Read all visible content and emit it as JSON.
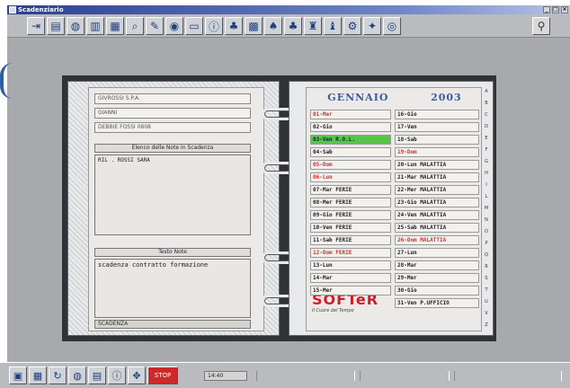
{
  "window": {
    "title": "Scadenziario"
  },
  "toolbar": {
    "icons": [
      "exit-door-icon",
      "card-icon",
      "globe-card-icon",
      "chart-icon",
      "books-icon",
      "search-card-icon",
      "pencil-card-icon",
      "globe-icon",
      "info-icon",
      "palm-icon",
      "calendar-icon",
      "tree-icon",
      "palm-tree-icon",
      "pen-holder-icon",
      "bottle-icon",
      "gear-card-icon",
      "wrench-card-icon",
      "cd-icon"
    ],
    "exit_icon": "person-door-icon"
  },
  "left_page": {
    "fields": [
      "GIVROSSI S.P.A.",
      "GIANNI",
      "DEBBIE FOSSI 0808"
    ],
    "scadenze_title": "Elenco delle Note in Scadenza",
    "scadenze_items": [
      "RIL . ROSSI SARA"
    ],
    "note_title": "Testo Note",
    "note_text": "scadenza contratto formazione",
    "bottom_label": "SCADENZA"
  },
  "calendar": {
    "month": "GENNAIO",
    "year": "2003",
    "left_column": [
      {
        "label": "01-Mer",
        "style": "red"
      },
      {
        "label": "02-Gio",
        "style": "normal"
      },
      {
        "label": "03-Ven R.O.L.",
        "style": "selected"
      },
      {
        "label": "04-Sab",
        "style": "normal"
      },
      {
        "label": "05-Dom",
        "style": "red"
      },
      {
        "label": "06-Lun",
        "style": "red"
      },
      {
        "label": "07-Mar FERIE",
        "style": "normal"
      },
      {
        "label": "08-Mer FERIE",
        "style": "normal"
      },
      {
        "label": "09-Gio FERIE",
        "style": "normal"
      },
      {
        "label": "10-Ven FERIE",
        "style": "normal"
      },
      {
        "label": "11-Sab FERIE",
        "style": "normal"
      },
      {
        "label": "12-Dom FERIE",
        "style": "red"
      },
      {
        "label": "13-Lun",
        "style": "normal"
      },
      {
        "label": "14-Mar",
        "style": "normal"
      },
      {
        "label": "15-Mer",
        "style": "normal"
      }
    ],
    "right_column": [
      {
        "label": "16-Gio",
        "style": "normal"
      },
      {
        "label": "17-Ven",
        "style": "normal"
      },
      {
        "label": "18-Sab",
        "style": "normal"
      },
      {
        "label": "19-Dom",
        "style": "red"
      },
      {
        "label": "20-Lun MALATTIA",
        "style": "normal"
      },
      {
        "label": "21-Mar MALATTIA",
        "style": "normal"
      },
      {
        "label": "22-Mer MALATTIA",
        "style": "normal"
      },
      {
        "label": "23-Gio MALATTIA",
        "style": "normal"
      },
      {
        "label": "24-Ven MALATTIA",
        "style": "normal"
      },
      {
        "label": "25-Sab MALATTIA",
        "style": "normal"
      },
      {
        "label": "26-Dom MALATTIA",
        "style": "red"
      },
      {
        "label": "27-Lun",
        "style": "normal"
      },
      {
        "label": "28-Mar",
        "style": "normal"
      },
      {
        "label": "29-Mer",
        "style": "normal"
      },
      {
        "label": "30-Gio",
        "style": "normal"
      },
      {
        "label": "31-Ven P.UFFICIO",
        "style": "normal"
      }
    ],
    "alphabet": [
      "A",
      "B",
      "C",
      "D",
      "E",
      "F",
      "G",
      "H",
      "I",
      "L",
      "M",
      "N",
      "O",
      "P",
      "Q",
      "R",
      "S",
      "T",
      "U",
      "V",
      "Z"
    ]
  },
  "logo": {
    "name": "SOFTeR",
    "tagline": "Il Cuore del Tempo"
  },
  "taskbar": {
    "clock": "14:40",
    "icons": [
      "monitor-icon",
      "grid-icon",
      "refresh-icon",
      "globe-icon",
      "book-icon",
      "info-icon",
      "move-icon",
      "stop-icon"
    ]
  },
  "colors": {
    "accent_blue": "#2b5fa5",
    "holiday_red": "#d53030",
    "selected_green": "#5ac44a",
    "logo_red": "#cc1f2a"
  }
}
